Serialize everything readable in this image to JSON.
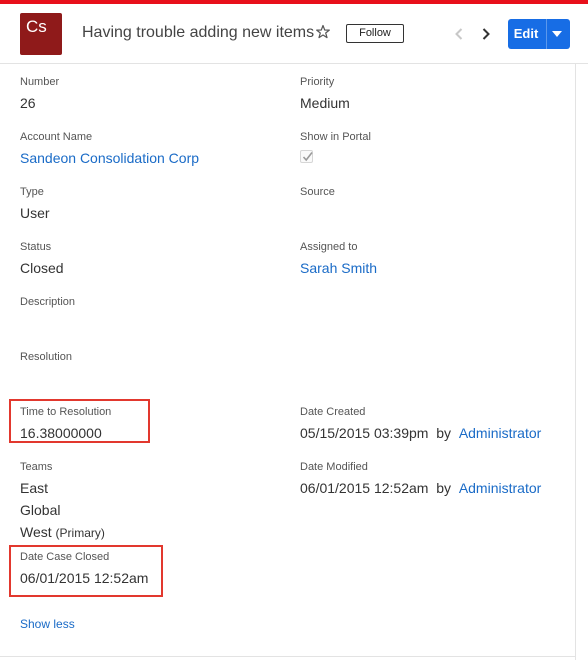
{
  "header": {
    "avatar_text": "Cs",
    "avatar_color": "#8f1a1a",
    "title": "Having trouble adding new items",
    "follow_label": "Follow",
    "edit_label": "Edit",
    "accent_color": "#e8101b",
    "edit_color": "#176de5",
    "icons": [
      "star-icon",
      "chevron-left-icon",
      "chevron-right-icon",
      "caret-down-icon"
    ]
  },
  "fields": {
    "number": {
      "label": "Number",
      "value": "26"
    },
    "priority": {
      "label": "Priority",
      "value": "Medium"
    },
    "account_name": {
      "label": "Account Name",
      "value": "Sandeon Consolidation Corp"
    },
    "show_in_portal": {
      "label": "Show in Portal",
      "checked": true
    },
    "type": {
      "label": "Type",
      "value": "User"
    },
    "source": {
      "label": "Source",
      "value": ""
    },
    "status": {
      "label": "Status",
      "value": "Closed"
    },
    "assigned_to": {
      "label": "Assigned to",
      "value": "Sarah Smith"
    },
    "description": {
      "label": "Description",
      "value": ""
    },
    "resolution": {
      "label": "Resolution",
      "value": ""
    },
    "time_to_resolution": {
      "label": "Time to Resolution",
      "value": "16.38000000"
    },
    "date_created": {
      "label": "Date Created",
      "date": "05/15/2015 03:39pm",
      "by": "by",
      "user": "Administrator"
    },
    "teams": {
      "label": "Teams",
      "items": [
        "East",
        "Global",
        "West"
      ],
      "primary_tag": "(Primary)"
    },
    "date_modified": {
      "label": "Date Modified",
      "date": "06/01/2015 12:52am",
      "by": "by",
      "user": "Administrator"
    },
    "date_case_closed": {
      "label": "Date Case Closed",
      "value": "06/01/2015 12:52am"
    }
  },
  "show_less_label": "Show less",
  "highlight_color": "#e2382e",
  "link_color": "#1a6bc7"
}
